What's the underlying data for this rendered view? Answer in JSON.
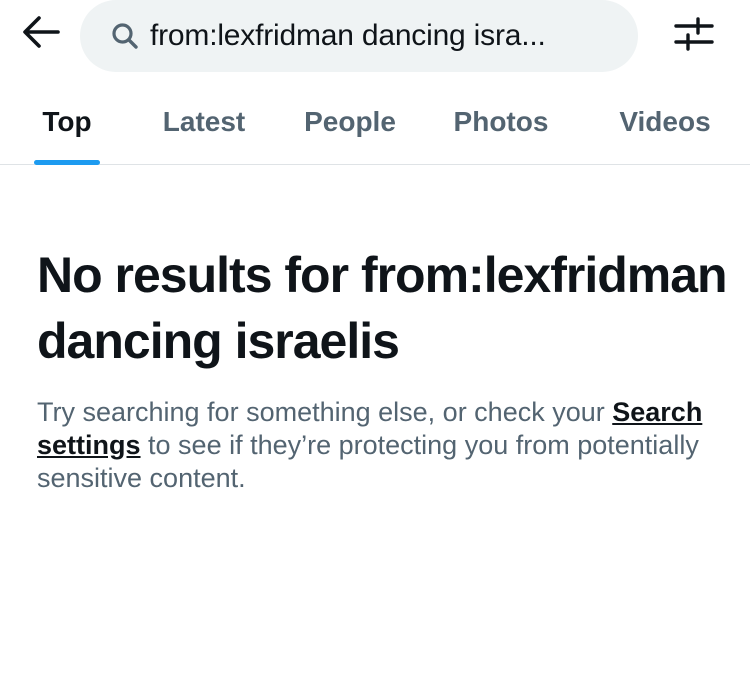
{
  "search": {
    "query": "from:lexfridman dancing isra..."
  },
  "icons": {
    "back": "arrow-left-icon",
    "search": "search-icon",
    "filter": "sliders-icon"
  },
  "tabs": [
    {
      "label": "Top",
      "active": true
    },
    {
      "label": "Latest",
      "active": false
    },
    {
      "label": "People",
      "active": false
    },
    {
      "label": "Photos",
      "active": false
    },
    {
      "label": "Videos",
      "active": false
    }
  ],
  "empty_state": {
    "title": "No results for from:lexfridman dancing israelis",
    "desc_before": "Try searching for something else, or check your ",
    "link": "Search settings",
    "desc_after": " to see if they’re protecting you from potentially sensitive content."
  },
  "colors": {
    "accent": "#1d9bf0",
    "text_primary": "#0f1419",
    "text_secondary": "#536471",
    "search_bg": "#eff3f4"
  }
}
